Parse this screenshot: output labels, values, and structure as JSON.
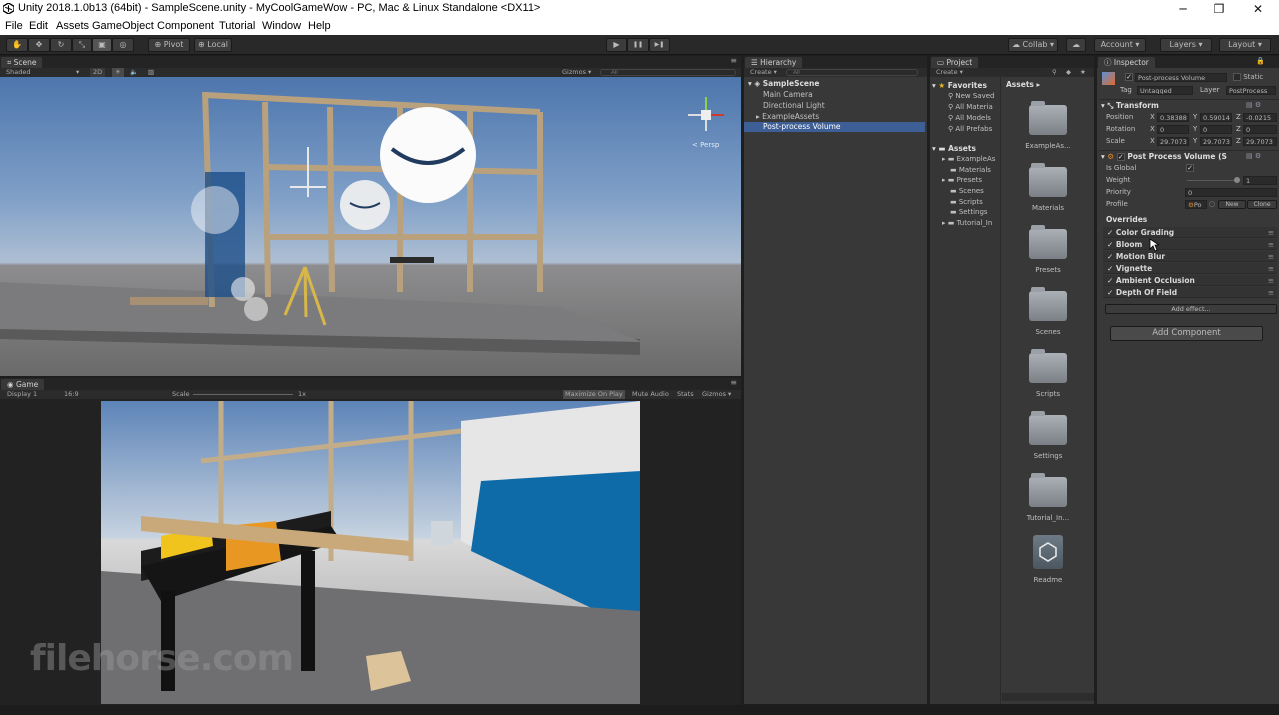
{
  "window": {
    "title": "Unity 2018.1.0b13 (64bit) - SampleScene.unity - MyCoolGameWow - PC, Mac & Linux Standalone <DX11>",
    "minimize": "─",
    "maximize": "❐",
    "close": "✕"
  },
  "menu": [
    "File",
    "Edit",
    "Assets",
    "GameObject",
    "Component",
    "Tutorial",
    "Window",
    "Help"
  ],
  "toolbar": {
    "pivot": "Pivot",
    "local": "Local",
    "play": "▶",
    "pause": "❚❚",
    "step": "▶❚",
    "collab": "Collab ▾",
    "account": "Account ▾",
    "layers": "Layers ▾",
    "layout": "Layout ▾"
  },
  "scene": {
    "tab": "Scene",
    "shading": "Shaded",
    "mode2d": "2D",
    "gizmos": "Gizmos ▾",
    "search_placeholder": "All",
    "persp": "< Persp"
  },
  "game": {
    "tab": "Game",
    "display": "Display 1",
    "aspect": "16:9",
    "scale_label": "Scale",
    "scale_value": "1x",
    "maximize": "Maximize On Play",
    "mute": "Mute Audio",
    "stats": "Stats",
    "gizmos": "Gizmos ▾"
  },
  "hierarchy": {
    "tab": "Hierarchy",
    "create": "Create ▾",
    "search_placeholder": "All",
    "scene": "SampleScene",
    "items": [
      "Main Camera",
      "Directional Light",
      "ExampleAssets",
      "Post-process Volume"
    ],
    "selected_index": 3
  },
  "project": {
    "tab": "Project",
    "create": "Create ▾",
    "favorites": "Favorites",
    "fav_items": [
      "New Saved",
      "All Materia",
      "All Models",
      "All Prefabs"
    ],
    "assets_root": "Assets",
    "tree": [
      "ExampleAs",
      "Materials",
      "Presets",
      "Scenes",
      "Scripts",
      "Settings",
      "Tutorial_In"
    ],
    "breadcrumb": "Assets ▸",
    "grid": [
      "ExampleAs...",
      "Materials",
      "Presets",
      "Scenes",
      "Scripts",
      "Settings",
      "Tutorial_In...",
      "Readme"
    ]
  },
  "inspector": {
    "tab": "Inspector",
    "object_name": "Post-process Volume",
    "static": "Static",
    "tag_label": "Tag",
    "tag": "Untagged",
    "layer_label": "Layer",
    "layer": "PostProcess",
    "transform": {
      "title": "Transform",
      "position": {
        "label": "Position",
        "x": "0.38388",
        "y": "0.59014",
        "z": "-0.0215"
      },
      "rotation": {
        "label": "Rotation",
        "x": "0",
        "y": "0",
        "z": "0"
      },
      "scale": {
        "label": "Scale",
        "x": "29.7073",
        "y": "29.7073",
        "z": "29.7073"
      }
    },
    "ppv": {
      "title": "Post Process Volume (S",
      "is_global": "Is Global",
      "weight": "Weight",
      "weight_value": "1",
      "weight_fraction": 1.0,
      "priority": "Priority",
      "priority_value": "0",
      "profile": "Profile",
      "profile_value": "Po",
      "new": "New",
      "clone": "Clone"
    },
    "overrides_label": "Overrides",
    "overrides": [
      "Color Grading",
      "Bloom",
      "Motion Blur",
      "Vignette",
      "Ambient Occlusion",
      "Depth Of Field"
    ],
    "add_effect": "Add effect...",
    "add_component": "Add Component"
  },
  "watermark": "filehorse.com",
  "colors": {
    "selection": "#3e5f96",
    "panel": "#383838",
    "sky": "#5f86b8",
    "blue_wall": "#0f6aa8"
  }
}
